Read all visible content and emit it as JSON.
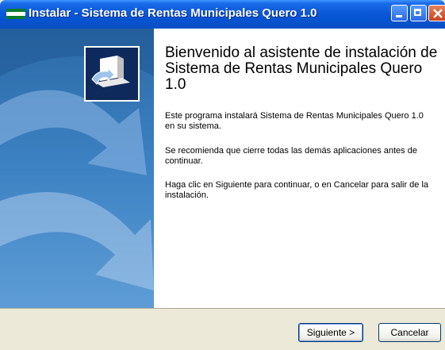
{
  "window": {
    "title": "Instalar - Sistema de Rentas Municipales Quero 1.0"
  },
  "icons": {
    "app": "app-icon",
    "minimize": "minimize-icon",
    "maximize": "maximize-icon",
    "close": "close-icon",
    "setup": "setup-computer-icon"
  },
  "wizard": {
    "heading": "Bienvenido al asistente de instalación de Sistema de Rentas Municipales Quero 1.0",
    "paragraph1": "Este programa instalará Sistema de Rentas Municipales Quero 1.0 en su sistema.",
    "paragraph2": "Se recomienda que cierre todas las demás aplicaciones antes de continuar.",
    "paragraph3": "Haga clic en Siguiente para continuar, o en Cancelar para salir de la instalación."
  },
  "buttons": {
    "next": "Siguiente >",
    "cancel": "Cancelar"
  },
  "colors": {
    "titlebar": "#0A58D8",
    "sidebar": "#3D82C3",
    "dialog_background": "#ECE9D8"
  }
}
